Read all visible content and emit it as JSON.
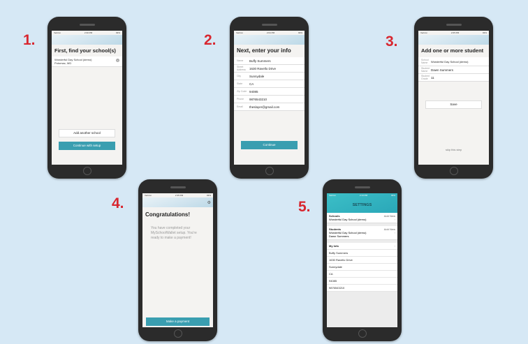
{
  "steps": {
    "s1": "1.",
    "s2": "2.",
    "s3": "3.",
    "s4": "4.",
    "s5": "5."
  },
  "status": {
    "carrier": "Verizon",
    "time1": "2:30 PM",
    "time2": "2:04 PM",
    "time3": "2:05 PM",
    "time4": "2:35 PM",
    "time5": "2:13 PM",
    "battery": "93%"
  },
  "screen1": {
    "title": "First, find your school(s)",
    "school_name": "Wonderful Day School (demo)",
    "school_location": "Potomac, MD",
    "add_button": "Add another school",
    "continue_button": "Continue with setup"
  },
  "screen2": {
    "title": "Next, enter your info",
    "fields": [
      {
        "label": "Name",
        "value": "Buffy Summers"
      },
      {
        "label": "Street Address",
        "value": "1630 Ravello Drive"
      },
      {
        "label": "City",
        "value": "Sunnydale"
      },
      {
        "label": "State",
        "value": "CA"
      },
      {
        "label": "Zip Code",
        "value": "94085"
      },
      {
        "label": "Phone",
        "value": "9876543210"
      },
      {
        "label": "Email",
        "value": "theslayer@gmail.com"
      }
    ],
    "continue_button": "Continue"
  },
  "screen3": {
    "title": "Add one or more student",
    "fields": [
      {
        "label": "School Name",
        "value": "Wonderful Day School (demo)"
      },
      {
        "label": "Student Name",
        "value": "Dawn Summers"
      },
      {
        "label": "Student Grade",
        "value": "11"
      }
    ],
    "save_button": "Save",
    "skip_link": "skip this step"
  },
  "screen4": {
    "title": "Congratulations!",
    "message": "You have completed your MySchoolWallet setup. You're ready to make a payment!",
    "payment_button": "Make a payment"
  },
  "screen5": {
    "title": "SETTINGS",
    "schools_label": "Schools",
    "schools_add": "Add New",
    "school_value": "Wonderful Day School (demo)",
    "students_label": "Students",
    "students_add": "Add New",
    "student_school": "Wonderful Day School (demo)",
    "student_name": "Dawn Summers",
    "myinfo_label": "My Info",
    "info_rows": [
      "Buffy Summers",
      "1630 Ravello Drive",
      "Sunnydale",
      "CA",
      "94085",
      "9876543210"
    ]
  }
}
